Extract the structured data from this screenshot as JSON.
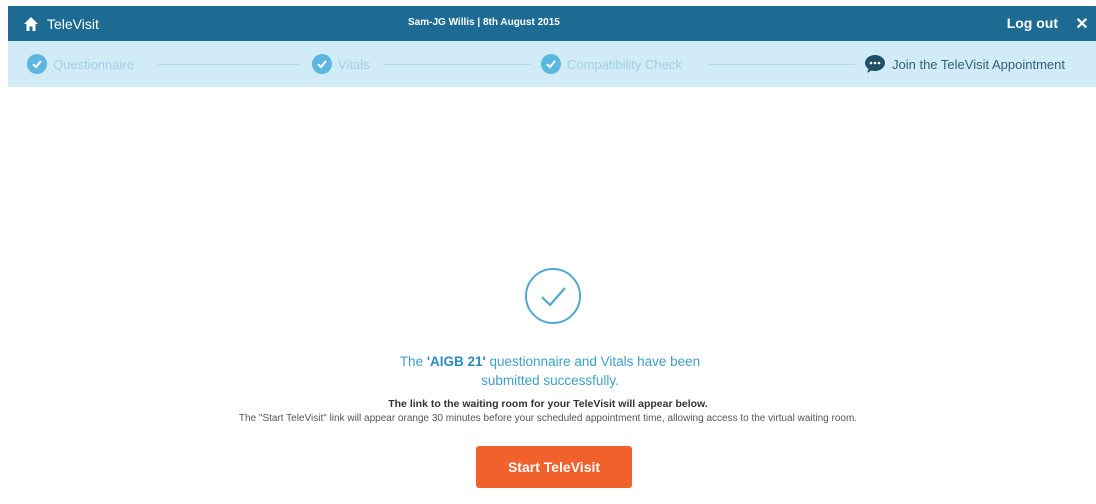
{
  "header": {
    "app_title": "TeleVisit",
    "patient_info": "Sam-JG Willis | 8th August 2015",
    "logout_label": "Log out",
    "close_label": "✕",
    "home_icon": "home-icon",
    "close_icon": "close-icon"
  },
  "steps": [
    {
      "label": "Questionnaire",
      "status": "completed",
      "icon": "check-circle-icon"
    },
    {
      "label": "Vitals",
      "status": "completed",
      "icon": "check-circle-icon"
    },
    {
      "label": "Compatibility Check",
      "status": "completed",
      "icon": "check-circle-icon"
    },
    {
      "label": "Join the TeleVisit Appointment",
      "status": "current",
      "icon": "chat-bubble-icon"
    }
  ],
  "main": {
    "success_icon": "check-circle-outline-icon",
    "success_prefix": "The ",
    "questionnaire_name": "'AIGB 21'",
    "success_suffix_line1": " questionnaire and Vitals have been",
    "success_line2": "submitted successfully.",
    "info_line1": "The link to the waiting room for your TeleVisit will appear below.",
    "info_line2": "The \"Start TeleVisit\" link will appear orange 30 minutes before your scheduled appointment time, allowing access to the virtual waiting room.",
    "start_button_label": "Start TeleVisit"
  },
  "colors": {
    "header_bg": "#1d6b93",
    "steps_bg": "#d2ecf7",
    "step_check": "#5bb7df",
    "accent_text": "#3d9fca",
    "button": "#f0612b"
  }
}
